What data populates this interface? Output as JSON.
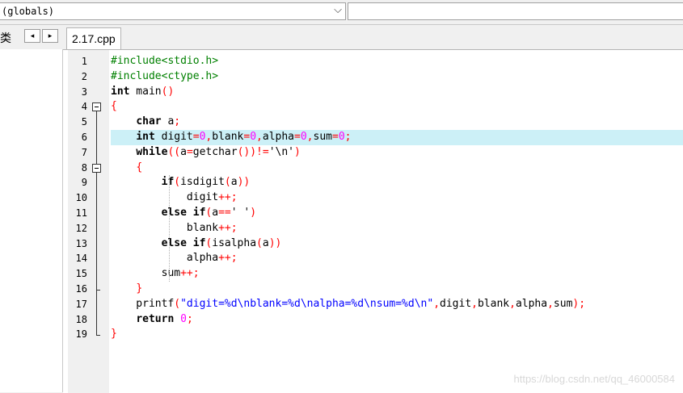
{
  "toolbar": {
    "scope_value": "(globals)",
    "scope_arrow": "⌵",
    "class_label": "类",
    "prev_glyph": "◂",
    "next_glyph": "▸"
  },
  "tabs": [
    {
      "label": "2.17.cpp",
      "active": true
    }
  ],
  "editor": {
    "highlighted_line": 6,
    "lines": [
      {
        "n": "1"
      },
      {
        "n": "2"
      },
      {
        "n": "3"
      },
      {
        "n": "4"
      },
      {
        "n": "5"
      },
      {
        "n": "6"
      },
      {
        "n": "7"
      },
      {
        "n": "8"
      },
      {
        "n": "9"
      },
      {
        "n": "10"
      },
      {
        "n": "11"
      },
      {
        "n": "12"
      },
      {
        "n": "13"
      },
      {
        "n": "14"
      },
      {
        "n": "15"
      },
      {
        "n": "16"
      },
      {
        "n": "17"
      },
      {
        "n": "18"
      },
      {
        "n": "19"
      }
    ],
    "code": [
      "#include<stdio.h>",
      "#include<ctype.h>",
      "int main()",
      "{",
      "    char a;",
      "    int digit=0,blank=0,alpha=0,sum=0;",
      "    while((a=getchar())!='\\n')",
      "    {",
      "        if(isdigit(a))",
      "            digit++;",
      "        else if(a==' ')",
      "            blank++;",
      "        else if(isalpha(a))",
      "            alpha++;",
      "        sum++;",
      "    }",
      "    printf(\"digit=%d\\nblank=%d\\nalpha=%d\\nsum=%d\\n\",digit,blank,alpha,sum);",
      "    return 0;",
      "}"
    ]
  },
  "watermark": "https://blog.csdn.net/qq_46000584",
  "colors": {
    "keyword": "#000000",
    "preprocessor": "#008000",
    "operator": "#ff0000",
    "number": "#ff00ff",
    "string": "#0000ff",
    "current_line": "#ccf0f7"
  }
}
